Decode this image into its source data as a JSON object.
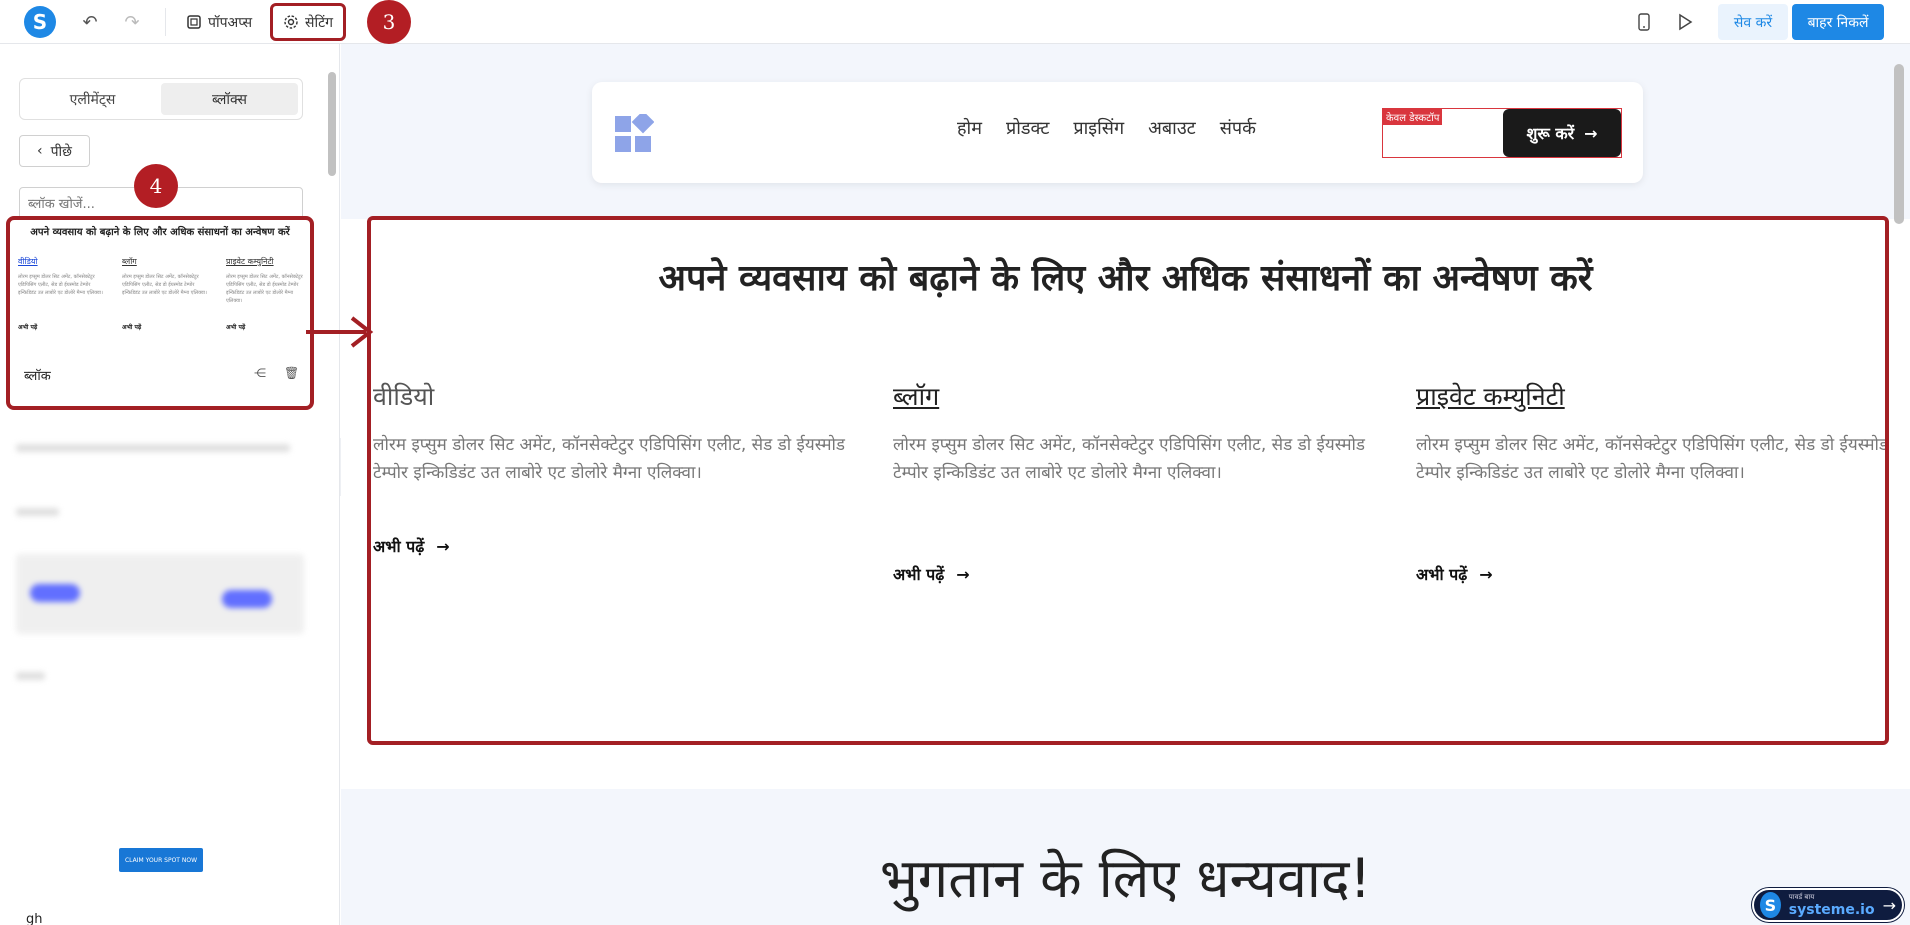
{
  "toolbar": {
    "logo": "S",
    "popups_label": "पॉपअप्स",
    "settings_label": "सेटिंग",
    "step3": "3",
    "save_label": "सेव करें",
    "exit_label": "बाहर निकलें"
  },
  "sidebar": {
    "tabs": [
      "एलीमेंट्स",
      "ब्लॉक्स"
    ],
    "back_label": "पीछे",
    "search_placeholder": "ब्लॉक खोजें...",
    "step4": "4",
    "card": {
      "mini_title": "अपने व्यवसाय को बढ़ाने के लिए और अधिक संसाधनों का अन्वेषण करें",
      "cols": [
        {
          "h": "वीडियो",
          "p": "लोरम इप्सुम डोलर सिट अमेंट, कॉनसेक्टेटुर एडिपिसिंग एलीट, सेड डो ईयस्मोड टेम्पोर इन्किडिडंट उत लाबोरे एट डोलोरे मैग्ना एलिक्वा।",
          "r": "अभी पढ़ें"
        },
        {
          "h": "ब्लॉग",
          "p": "लोरम इप्सुम डोलर सिट अमेंट, कॉनसेक्टेटुर एडिपिसिंग एलीट, सेड डो ईयस्मोड टेम्पोर इन्किडिडंट उत लाबोरे एट डोलोरे मैग्ना एलिक्वा।",
          "r": "अभी पढ़ें"
        },
        {
          "h": "प्राइवेट कम्युनिटी",
          "p": "लोरम इप्सुम डोलर सिट अमेंट, कॉनसेक्टेटुर एडिपिसिंग एलीट, सेड डो ईयस्मोड टेम्पोर इन्किडिडंट उत लाबोरे एट डोलोरे मैग्ना एलिक्वा।",
          "r": "अभी पढ़ें"
        }
      ],
      "label": "ब्लॉक"
    },
    "claim_label": "CLAIM YOUR SPOT NOW",
    "gh_label": "gh"
  },
  "canvas": {
    "nav_links": [
      "होम",
      "प्रोडक्ट",
      "प्राइसिंग",
      "अबाउट",
      "संपर्क"
    ],
    "desktop_only": "केवल डेस्कटॉप",
    "start_label": "शुरू करें",
    "section_title": "अपने व्यवसाय को बढ़ाने के लिए और अधिक संसाधनों का अन्वेषण करें",
    "columns": [
      {
        "heading": "वीडियो",
        "text": "लोरम इप्सुम डोलर सिट अमेंट, कॉनसेक्टेटुर एडिपिसिंग एलीट, सेड डो ईयस्मोड टेम्पोर इन्किडिडंट उत लाबोरे एट डोलोरे मैग्ना एलिक्वा।",
        "read_more": "अभी पढ़ें"
      },
      {
        "heading": "ब्लॉग",
        "text": "लोरम इप्सुम डोलर सिट अमेंट, कॉनसेक्टेटुर एडिपिसिंग एलीट, सेड डो ईयस्मोड टेम्पोर इन्किडिडंट उत लाबोरे एट डोलोरे मैग्ना एलिक्वा।",
        "read_more": "अभी पढ़ें"
      },
      {
        "heading": "प्राइवेट कम्युनिटी",
        "text": "लोरम इप्सुम डोलर सिट अमेंट, कॉनसेक्टेटुर एडिपिसिंग एलीट, सेड डो ईयस्मोड टेम्पोर इन्किडिडंट उत लाबोरे एट डोलोरे मैग्ना एलिक्वा।",
        "read_more": "अभी पढ़ें"
      }
    ],
    "thanks": "भुगतान के लिए धन्यवाद!"
  },
  "powered": {
    "line1": "पावर्ड बाय",
    "line2": "systeme.io"
  },
  "colors": {
    "accent": "#1e88e5",
    "highlight": "#a31f24"
  }
}
